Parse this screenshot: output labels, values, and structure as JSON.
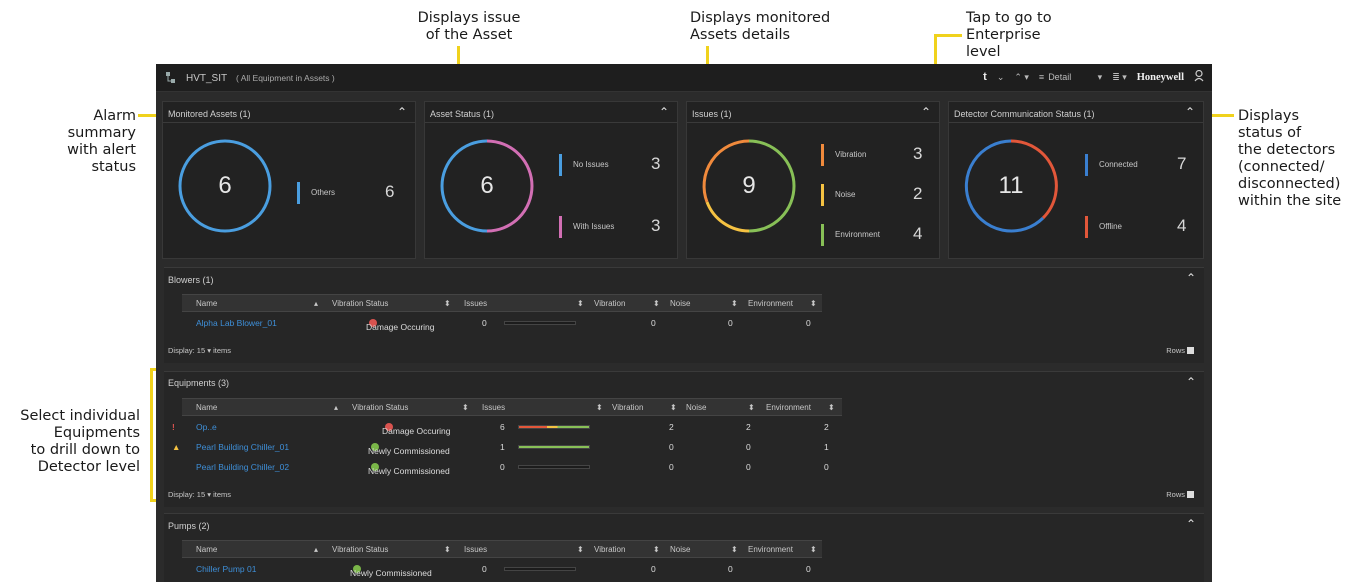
{
  "annotations": {
    "alarm": [
      "Alarm",
      "summary",
      "with alert",
      "status"
    ],
    "asset_issue": [
      "Displays issue",
      "of the Asset"
    ],
    "monitored": [
      "Displays monitored",
      "Assets details"
    ],
    "enterprise": [
      "Tap to go to",
      "Enterprise",
      "level"
    ],
    "detectors": [
      "Displays",
      "status of",
      "the detectors",
      "(connected/",
      "disconnected)",
      "within the site"
    ],
    "equip": [
      "Select individual",
      "Equipments",
      "to drill down to",
      "Detector level"
    ]
  },
  "topbar": {
    "title": "HVT_SIT",
    "subtitle": "( All Equipment in Assets )",
    "t_label": "t",
    "view": "Detail",
    "brand": "Honeywell"
  },
  "cards": {
    "monitored": {
      "title": "Monitored Assets (1)",
      "total": "6",
      "legend": [
        {
          "label": "Others",
          "value": "6",
          "color": "#4a9ee0"
        }
      ]
    },
    "asset_status": {
      "title": "Asset Status (1)",
      "total": "6",
      "legend": [
        {
          "label": "No Issues",
          "value": "3",
          "color": "#4a9ee0"
        },
        {
          "label": "With Issues",
          "value": "3",
          "color": "#d26fb4"
        }
      ]
    },
    "issues": {
      "title": "Issues (1)",
      "total": "9",
      "legend": [
        {
          "label": "Vibration",
          "value": "3",
          "color": "#f08a3c"
        },
        {
          "label": "Noise",
          "value": "2",
          "color": "#f5c242"
        },
        {
          "label": "Environment",
          "value": "4",
          "color": "#88c057"
        }
      ]
    },
    "detector": {
      "title": "Detector Communication Status (1)",
      "total": "11",
      "legend": [
        {
          "label": "Connected",
          "value": "7",
          "color": "#3a7fd0"
        },
        {
          "label": "Offline",
          "value": "4",
          "color": "#e2573a"
        }
      ]
    }
  },
  "columns": {
    "name": "Name",
    "vibration_status": "Vibration Status",
    "issues": "Issues",
    "vibration": "Vibration",
    "noise": "Noise",
    "environment": "Environment"
  },
  "display_label": "Display:",
  "display_count": "15",
  "items_label": "items",
  "rows_label": "Rows",
  "blowers": {
    "title": "Blowers (1)",
    "rows": [
      {
        "name": "Alpha Lab Blower_01",
        "status": "Damage Occuring",
        "issues": "0",
        "vibration": "0",
        "noise": "0",
        "environment": "0"
      }
    ]
  },
  "equipments": {
    "title": "Equipments (3)",
    "rows": [
      {
        "alert": "!",
        "name": "Op..e",
        "status": "Damage Occuring",
        "issues": "6",
        "vibration": "2",
        "noise": "2",
        "environment": "2"
      },
      {
        "alert": "▲",
        "name": "Pearl Building Chiller_01",
        "status": "Newly Commissioned",
        "issues": "1",
        "vibration": "0",
        "noise": "0",
        "environment": "1"
      },
      {
        "alert": "",
        "name": "Pearl Building Chiller_02",
        "status": "Newly Commissioned",
        "issues": "0",
        "vibration": "0",
        "noise": "0",
        "environment": "0"
      }
    ]
  },
  "pumps": {
    "title": "Pumps (2)",
    "rows": [
      {
        "name": "Chiller Pump 01",
        "status": "Newly Commissioned",
        "issues": "0",
        "vibration": "0",
        "noise": "0",
        "environment": "0"
      }
    ]
  },
  "issue_bars": {
    "equip0_fill": 1.0,
    "equip1_fill": 1.0
  }
}
